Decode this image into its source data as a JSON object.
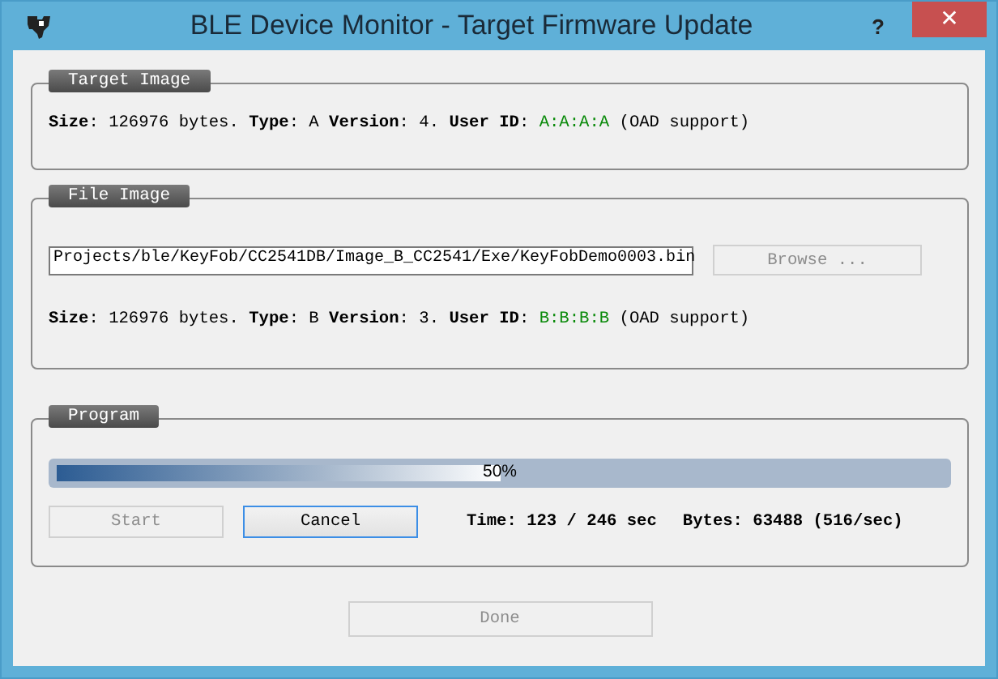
{
  "window": {
    "title": "BLE Device Monitor - Target Firmware Update",
    "help": "?",
    "close": "✕"
  },
  "target_image": {
    "title": "Target Image",
    "info": [
      {
        "kind": "label",
        "text": "Size"
      },
      {
        "kind": "plain",
        "text": ": 126976 bytes. "
      },
      {
        "kind": "label",
        "text": "Type"
      },
      {
        "kind": "plain",
        "text": ": A "
      },
      {
        "kind": "label",
        "text": "Version"
      },
      {
        "kind": "plain",
        "text": ": 4. "
      },
      {
        "kind": "label",
        "text": "User ID"
      },
      {
        "kind": "plain",
        "text": ": "
      },
      {
        "kind": "id",
        "text": "A:A:A:A"
      },
      {
        "kind": "plain",
        "text": " (OAD support)"
      }
    ]
  },
  "file_image": {
    "title": "File Image",
    "path": "Projects/ble/KeyFob/CC2541DB/Image_B_CC2541/Exe/KeyFobDemo0003.bin",
    "browse": {
      "label": "Browse ...",
      "disabled": true
    },
    "info": [
      {
        "kind": "label",
        "text": "Size"
      },
      {
        "kind": "plain",
        "text": ": 126976 bytes. "
      },
      {
        "kind": "label",
        "text": "Type"
      },
      {
        "kind": "plain",
        "text": ": B "
      },
      {
        "kind": "label",
        "text": "Version"
      },
      {
        "kind": "plain",
        "text": ": 3. "
      },
      {
        "kind": "label",
        "text": "User ID"
      },
      {
        "kind": "plain",
        "text": ": "
      },
      {
        "kind": "id",
        "text": "B:B:B:B"
      },
      {
        "kind": "plain",
        "text": " (OAD support)"
      }
    ]
  },
  "program": {
    "title": "Program",
    "progress": {
      "level": 0.5,
      "label": "50%"
    },
    "start": {
      "label": "Start",
      "disabled": true
    },
    "cancel": {
      "label": "Cancel",
      "disabled": false
    },
    "time": "Time: 123 / 246 sec",
    "bytes": "Bytes: 63488 (516/sec)"
  },
  "done": {
    "label": "Done",
    "disabled": true
  }
}
